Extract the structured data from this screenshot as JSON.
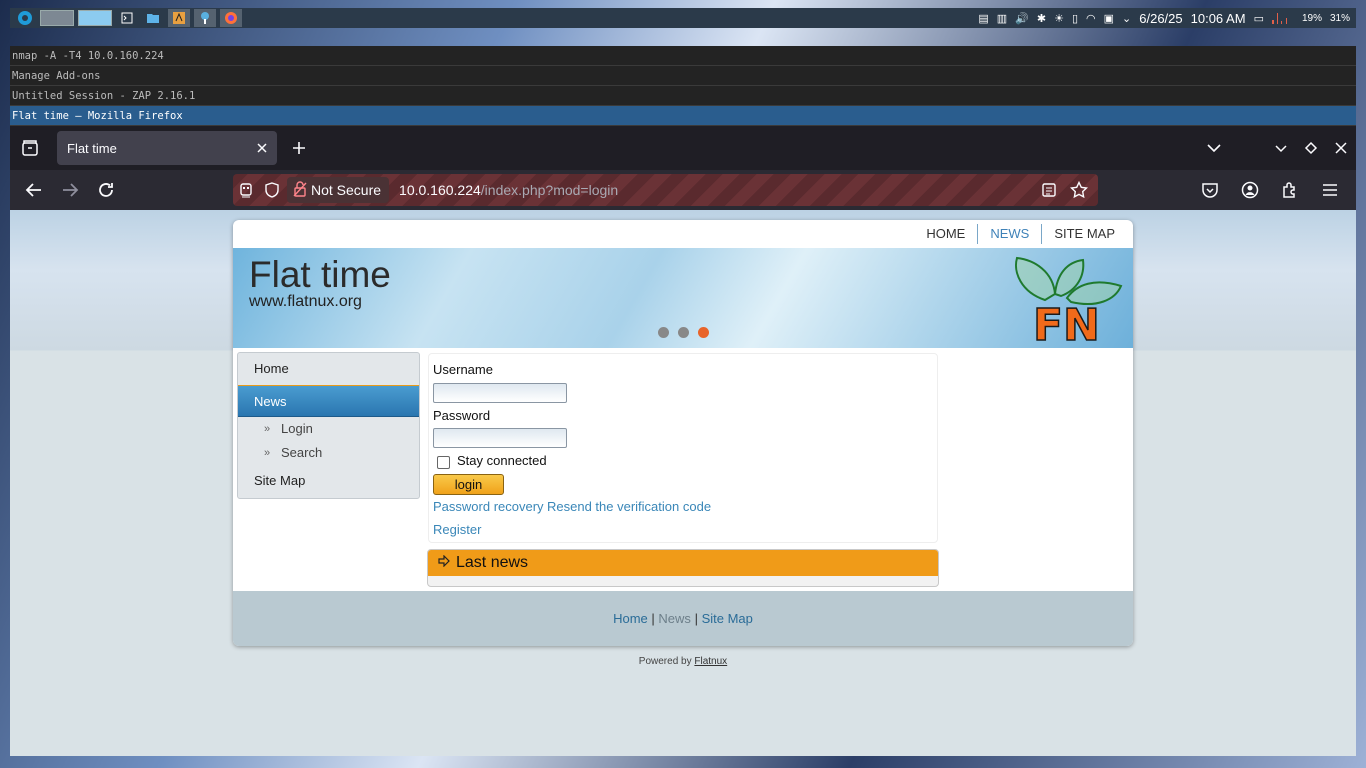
{
  "panel": {
    "date": "6/26/25",
    "time": "10:06 AM",
    "battery_a": "19%",
    "battery_b": "31%"
  },
  "tasks": [
    {
      "label": "nmap -A -T4 10.0.160.224"
    },
    {
      "label": "Manage Add-ons"
    },
    {
      "label": "Untitled Session - ZAP 2.16.1"
    },
    {
      "label": "Flat time — Mozilla Firefox"
    }
  ],
  "browser": {
    "tab_title": "Flat time",
    "security_label": "Not Secure",
    "url_host": "10.0.160.224",
    "url_path": "/index.php?mod=login"
  },
  "site": {
    "topnav": [
      "HOME",
      "NEWS",
      "SITE MAP"
    ],
    "title": "Flat time",
    "subtitle": "www.flatnux.org",
    "logo_text": "FN",
    "menu": {
      "home": "Home",
      "news": "News",
      "sub_login": "Login",
      "sub_search": "Search",
      "sitemap": "Site Map"
    },
    "login": {
      "username_label": "Username",
      "username_value": "",
      "password_label": "Password",
      "password_value": "",
      "stay_connected": "Stay connected",
      "login_button": "login",
      "recovery_link": "Password recovery",
      "resend_link": "Resend the verification code",
      "register_link": "Register"
    },
    "last_news_title": "Last news",
    "footer": {
      "home": "Home",
      "news": "News",
      "sitemap": "Site Map",
      "sep": "|"
    },
    "powered_by": "Powered by",
    "powered_link": "Flatnux"
  },
  "colors": {
    "accent_blue": "#3a87b8",
    "menu_active": "#2a76b0",
    "orange": "#f09b18",
    "slider_active_dot": "#e8642a"
  }
}
